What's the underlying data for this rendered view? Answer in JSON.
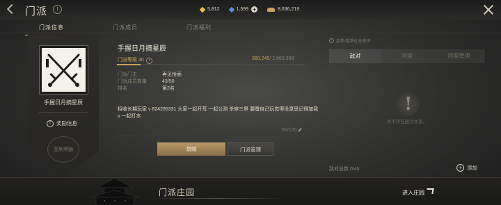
{
  "header": {
    "title": "门派",
    "currencies": [
      {
        "icon": "gold-diamond-icon",
        "value": "5,812"
      },
      {
        "icon": "blue-diamond-icon",
        "value": "1,599"
      },
      {
        "icon": "ingot-icon",
        "value": "8,636,219"
      }
    ]
  },
  "tabs": [
    {
      "label": "门派信息",
      "active": true
    },
    {
      "label": "门派成员",
      "active": false
    },
    {
      "label": "门派福利",
      "active": false
    }
  ],
  "banner": {
    "name": "手握日月摘星辰",
    "reward_label": "奖励信息",
    "seal_label": "签到奖励"
  },
  "guild": {
    "name": "手握日月摘星辰",
    "level_label": "门派等级 30",
    "exp_current": "360,245",
    "exp_total": "/ 2,860,398",
    "exp_progress": 0.126,
    "rows": [
      {
        "key": "门派门主",
        "value": "再见怡面"
      },
      {
        "key": "门派成员数量",
        "value": "43/50"
      },
      {
        "key": "排名",
        "value": "第2名"
      }
    ],
    "notice": "招收长期玩家 v 824295331 大家一起开荒 一起公测 杀穿三界 要蚕自己玩觉得没意思记得加我v 一起打本",
    "notice_count": "95/100",
    "buttons": {
      "donate": "捐赠",
      "manage": "门派管理"
    }
  },
  "right": {
    "hint": "敌帮/盟帮优先顺序",
    "tabs": [
      {
        "label": "敌对",
        "active": true
      },
      {
        "label": "同盟",
        "active": false
      },
      {
        "label": "同盟管理",
        "active": false
      }
    ],
    "empty_text": "尚不存在敌对关系。",
    "enemy_total": "敌对总数 0/40",
    "add_label": "添加"
  },
  "footer": {
    "estate_label": "门派庄园",
    "enter_label": "进入庄园"
  },
  "colors": {
    "accent": "#c9a35a",
    "text": "#d8d2c4"
  }
}
